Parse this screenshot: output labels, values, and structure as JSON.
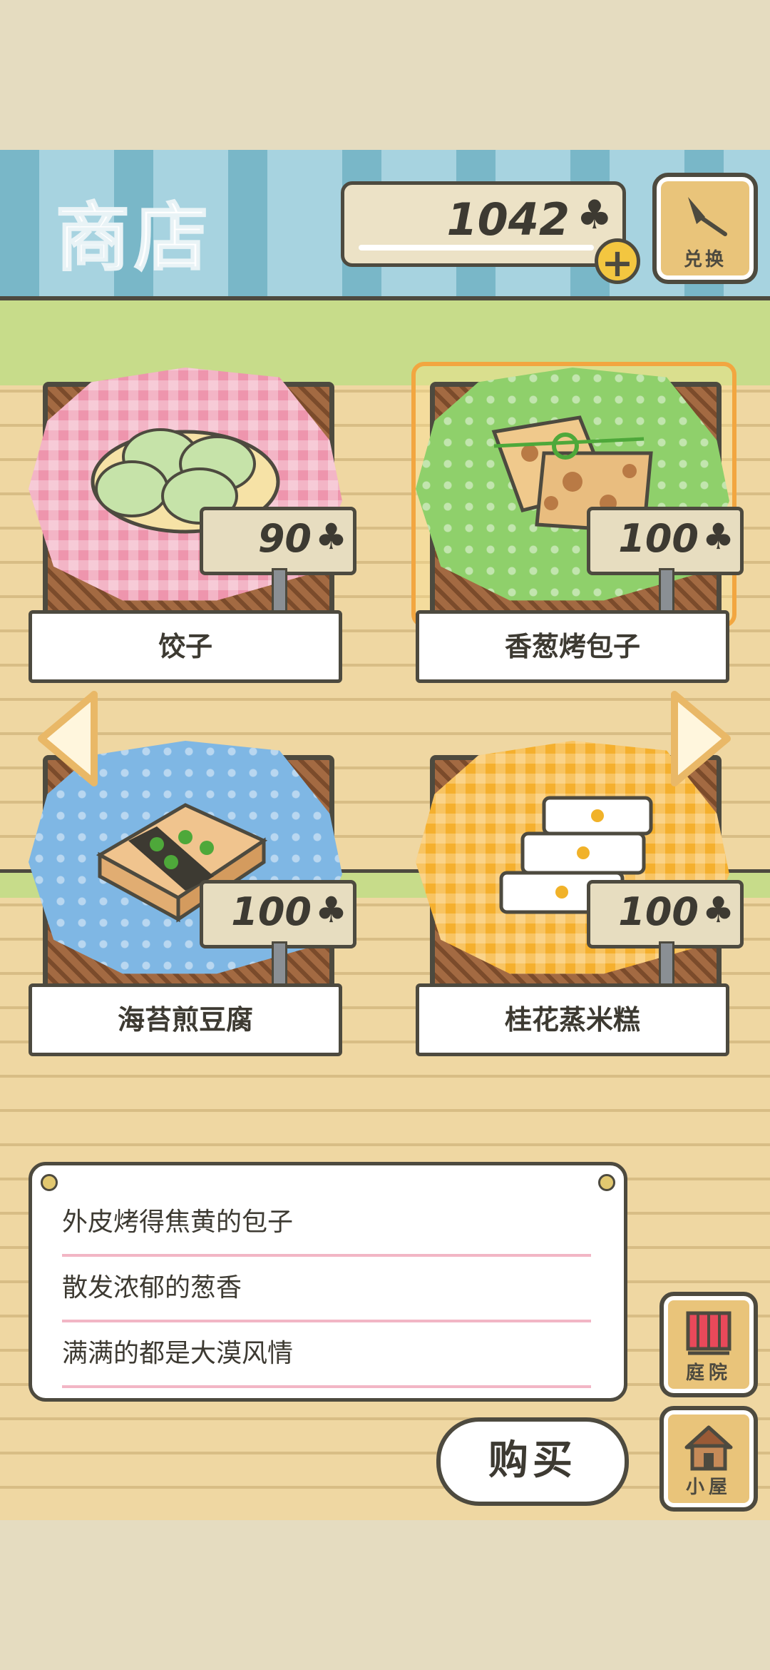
{
  "header": {
    "title": "商店",
    "coins": "1042",
    "coin_symbol": "♣",
    "plus": "+",
    "exchange_label": "兑换"
  },
  "items": [
    {
      "name": "饺子",
      "price": "90",
      "cloth": "pink"
    },
    {
      "name": "香葱烤包子",
      "price": "100",
      "cloth": "green",
      "selected": true
    },
    {
      "name": "海苔煎豆腐",
      "price": "100",
      "cloth": "blue"
    },
    {
      "name": "桂花蒸米糕",
      "price": "100",
      "cloth": "yellow"
    }
  ],
  "description": {
    "lines": [
      "外皮烤得焦黄的包子",
      "散发浓郁的葱香",
      "满满的都是大漠风情"
    ]
  },
  "buy_label": "购买",
  "side_buttons": [
    {
      "label": "庭院",
      "icon": "garden-gate-icon"
    },
    {
      "label": "小屋",
      "icon": "house-icon"
    }
  ],
  "colors": {
    "header_stripe": "#79b7c8",
    "shelf_green": "#c7dc8a",
    "wood": "#efd7a2",
    "outline": "#4d4a3f",
    "selected_highlight": "#f2a640"
  }
}
